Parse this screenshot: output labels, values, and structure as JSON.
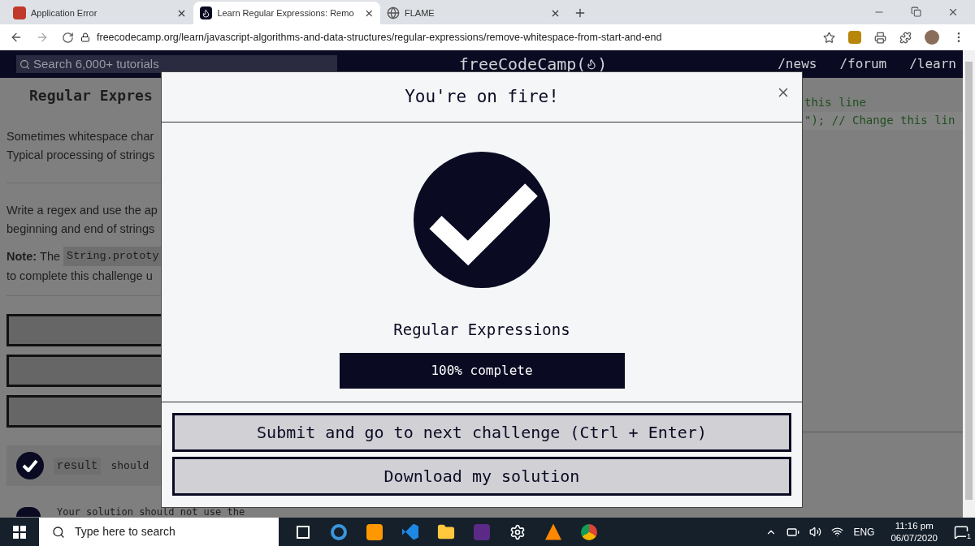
{
  "browser": {
    "tabs": [
      {
        "title": "Application Error",
        "kind": "error",
        "selected": false
      },
      {
        "title": "Learn Regular Expressions: Remo",
        "kind": "fcc",
        "selected": true
      },
      {
        "title": "FLAME",
        "kind": "globe",
        "selected": false
      }
    ],
    "url": "freecodecamp.org/learn/javascript-algorithms-and-data-structures/regular-expressions/remove-whitespace-from-start-and-end"
  },
  "navbar": {
    "search_placeholder": "Search 6,000+ tutorials",
    "logo_before": "freeCodeCamp(",
    "logo_after": ")",
    "links": [
      "/news",
      "/forum",
      "/learn"
    ]
  },
  "lesson": {
    "title": "Regular Expres",
    "blocks": [
      {
        "kind": "text",
        "lines": [
          "Sometimes whitespace char",
          "Typical processing of strings"
        ]
      },
      {
        "kind": "rule"
      },
      {
        "kind": "text",
        "lines": [
          "Write a regex and use the ap",
          "beginning and end of strings"
        ]
      },
      {
        "kind": "note",
        "label": "Note:",
        "text": "The",
        "code": "String.prototy",
        "rest": "to complete this challenge u"
      },
      {
        "kind": "rule"
      }
    ],
    "tests": [
      {
        "code": "result",
        "text": "should",
        "passed": true
      },
      {
        "text": "Your solution should not use the",
        "passed": true
      }
    ]
  },
  "editor": {
    "lines": [
      "this line",
      "\"); // Change this lin"
    ]
  },
  "modal": {
    "title": "You're on fire!",
    "block": "Regular Expressions",
    "progress": {
      "level": 1,
      "label": "100% complete"
    },
    "buttons": [
      "Submit and go to next challenge (Ctrl + Enter)",
      "Download my solution"
    ]
  },
  "taskbar": {
    "search_placeholder": "Type here to search",
    "language": "ENG",
    "time": "11:16 pm",
    "date": "06/07/2020",
    "notifications": "1"
  }
}
